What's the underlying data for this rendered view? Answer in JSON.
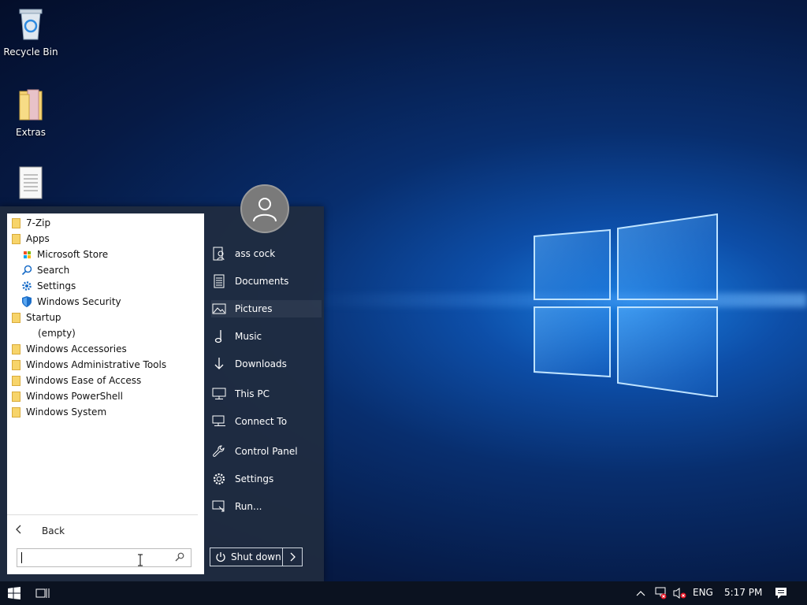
{
  "desktop": {
    "icons": [
      {
        "label": "Recycle Bin",
        "icon": "recycle-bin-icon"
      },
      {
        "label": "Extras",
        "icon": "folder-icon"
      },
      {
        "label": "",
        "icon": "document-icon"
      }
    ]
  },
  "start_menu": {
    "programs": [
      {
        "label": "7-Zip",
        "type": "folder"
      },
      {
        "label": "Apps",
        "type": "folder"
      },
      {
        "label": "Microsoft Store",
        "type": "app",
        "icon": "store-icon"
      },
      {
        "label": "Search",
        "type": "app",
        "icon": "search-icon"
      },
      {
        "label": "Settings",
        "type": "app",
        "icon": "gear-icon"
      },
      {
        "label": "Windows Security",
        "type": "app",
        "icon": "shield-icon"
      },
      {
        "label": "Startup",
        "type": "folder"
      },
      {
        "label": "(empty)",
        "type": "empty"
      },
      {
        "label": "Windows Accessories",
        "type": "folder"
      },
      {
        "label": "Windows Administrative Tools",
        "type": "folder"
      },
      {
        "label": "Windows Ease of Access",
        "type": "folder"
      },
      {
        "label": "Windows PowerShell",
        "type": "folder"
      },
      {
        "label": "Windows System",
        "type": "folder"
      }
    ],
    "back_label": "Back",
    "search_value": "",
    "right_items": [
      {
        "label": "ass cock",
        "icon": "user-folder-icon"
      },
      {
        "label": "Documents",
        "icon": "document-icon"
      },
      {
        "label": "Pictures",
        "icon": "pictures-icon"
      },
      {
        "label": "Music",
        "icon": "music-note-icon"
      },
      {
        "label": "Downloads",
        "icon": "download-arrow-icon"
      },
      {
        "label": "This PC",
        "icon": "computer-icon"
      },
      {
        "label": "Connect To",
        "icon": "network-icon"
      },
      {
        "label": "Control Panel",
        "icon": "wrench-icon"
      },
      {
        "label": "Settings",
        "icon": "gear-icon"
      },
      {
        "label": "Run...",
        "icon": "run-icon"
      }
    ],
    "shutdown_label": "Shut down"
  },
  "taskbar": {
    "language": "ENG",
    "time": "5:17 PM"
  },
  "colors": {
    "taskbar": "#0b1220",
    "start_menu": "#202c40",
    "folder": "#f7d46a"
  }
}
